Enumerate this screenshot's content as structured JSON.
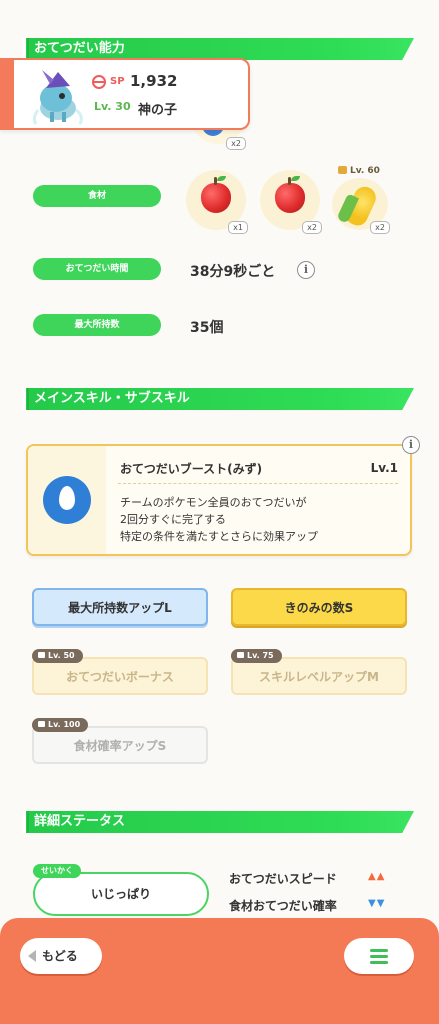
{
  "sections": {
    "help_ability": "おてつだい能力",
    "skills": "メインスキル・サブスキル",
    "details": "詳細ステータス"
  },
  "pokemon": {
    "sp_label": "SP",
    "sp_value": "1,932",
    "level": "Lv. 30",
    "name": "神の子",
    "partial_qty": "x2"
  },
  "stats": {
    "ingredients_label": "食材",
    "ingredients": [
      {
        "name": "apple",
        "qty": "x1"
      },
      {
        "name": "apple",
        "qty": "x2"
      },
      {
        "name": "corn",
        "qty": "x2",
        "unlock_level": "Lv. 60"
      }
    ],
    "help_time_label": "おてつだい時間",
    "help_time_value": "38分9秒ごと",
    "max_carry_label": "最大所持数",
    "max_carry_value": "35個"
  },
  "main_skill": {
    "name": "おてつだいブースト(みず)",
    "level": "Lv.1",
    "desc_line1": "チームのポケモン全員のおてつだいが",
    "desc_line2": "2回分すぐに完了する",
    "desc_line3": "特定の条件を満たすとさらに効果アップ"
  },
  "sub_skills": [
    {
      "label": "最大所持数アップL",
      "unlock": ""
    },
    {
      "label": "きのみの数S",
      "unlock": ""
    },
    {
      "label": "おてつだいボーナス",
      "unlock": "Lv. 50"
    },
    {
      "label": "スキルレベルアップM",
      "unlock": "Lv. 75"
    },
    {
      "label": "食材確率アップS",
      "unlock": "Lv. 100"
    }
  ],
  "nature": {
    "tag": "せいかく",
    "name": "いじっぱり",
    "up_stat": "おてつだいスピード",
    "up_arrows": "▲▲",
    "down_stat": "食材おてつだい確率",
    "down_arrows": "▼▼"
  },
  "nav": {
    "back": "もどる"
  },
  "colors": {
    "accent_green": "#3fd55a",
    "bottom_bar": "#f47a55",
    "skill_border": "#f1c557",
    "skill_icon": "#2f7fd6"
  }
}
